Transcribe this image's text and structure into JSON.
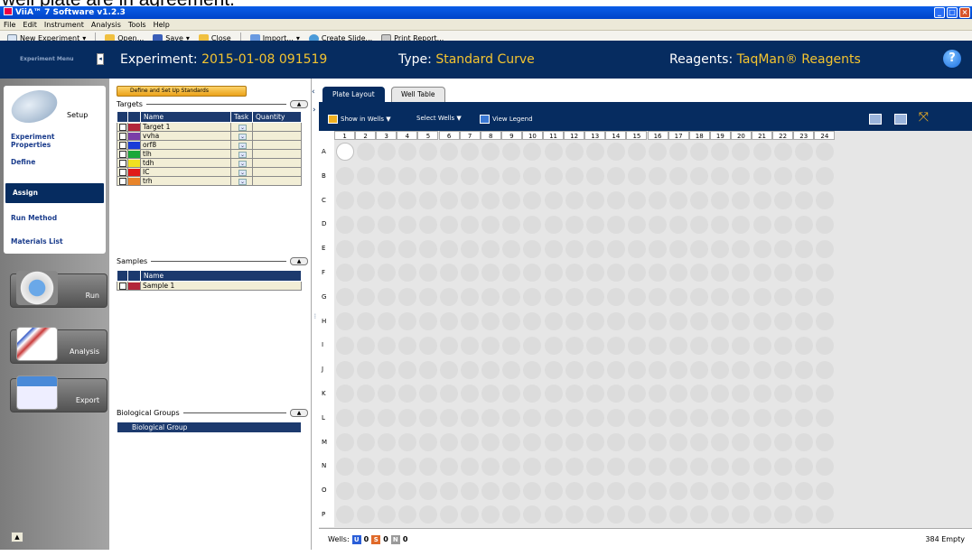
{
  "caption": "well plate are in agreement.",
  "window": {
    "title": "ViiA™ 7 Software v1.2.3",
    "buttons": [
      "_",
      "□",
      "×"
    ]
  },
  "menu": [
    "File",
    "Edit",
    "Instrument",
    "Analysis",
    "Tools",
    "Help"
  ],
  "toolbar": {
    "new_experiment": "New Experiment",
    "open": "Open...",
    "save": "Save",
    "close": "Close",
    "import": "Import...",
    "create_slide": "Create Slide...",
    "print_report": "Print Report..."
  },
  "sidebar": {
    "header": "Experiment Menu",
    "collapse": "◂",
    "setup": "Setup",
    "items": [
      "Experiment Properties",
      "Define",
      "Assign",
      "Run Method",
      "Materials List"
    ],
    "run": "Run",
    "analysis": "Analysis",
    "export": "Export",
    "scroll_up": "▲"
  },
  "header": {
    "exp_label": "Experiment:",
    "exp_value": "2015-01-08 091519",
    "type_label": "Type:",
    "type_value": "Standard Curve",
    "reag_label": "Reagents:",
    "reag_value": "TaqMan® Reagents",
    "help": "?"
  },
  "left": {
    "define_button": "Define and Set Up Standards",
    "targets_title": "Targets",
    "targets_headers": [
      "Name",
      "Task",
      "Quantity"
    ],
    "targets": [
      {
        "name": "Target 1",
        "color": "#b3263a"
      },
      {
        "name": "vvha",
        "color": "#7a3ea8"
      },
      {
        "name": "orf8",
        "color": "#1a3cd8"
      },
      {
        "name": "tlh",
        "color": "#1aa83a"
      },
      {
        "name": "tdh",
        "color": "#f0e020"
      },
      {
        "name": "IC",
        "color": "#e01a1a"
      },
      {
        "name": "trh",
        "color": "#e8842a"
      }
    ],
    "samples_title": "Samples",
    "samples_header": "Name",
    "samples": [
      {
        "name": "Sample 1",
        "color": "#b3263a"
      }
    ],
    "bio_title": "Biological Groups",
    "bio_header": "Biological Group",
    "collapse": "▲"
  },
  "plate": {
    "tabs": [
      "Plate Layout",
      "Well Table"
    ],
    "show_in_wells": "Show in Wells ▼",
    "select_wells": "Select Wells ▼",
    "view_legend": "View Legend",
    "columns": [
      "1",
      "2",
      "3",
      "4",
      "5",
      "6",
      "7",
      "8",
      "9",
      "10",
      "11",
      "12",
      "13",
      "14",
      "15",
      "16",
      "17",
      "18",
      "19",
      "20",
      "21",
      "22",
      "23",
      "24"
    ],
    "rows": [
      "A",
      "B",
      "C",
      "D",
      "E",
      "F",
      "G",
      "H",
      "I",
      "J",
      "K",
      "L",
      "M",
      "N",
      "O",
      "P"
    ]
  },
  "status": {
    "wells_label": "Wells:",
    "unknown_count": "0",
    "standard_count": "0",
    "ntc_count": "0",
    "empty_text": "384 Empty",
    "colors": {
      "unknown": "#2a5ed8",
      "standard": "#e06a2a",
      "ntc": "#9a9a9a"
    },
    "letters": [
      "U",
      "S",
      "N"
    ]
  }
}
